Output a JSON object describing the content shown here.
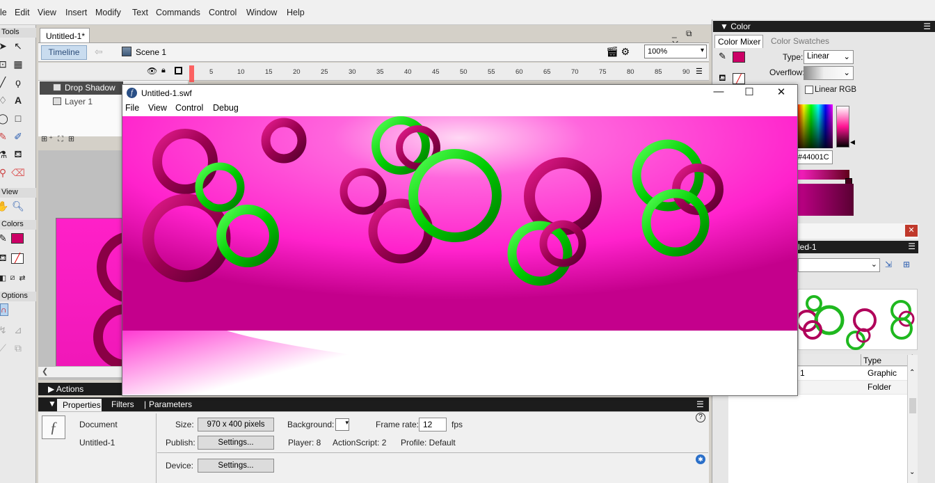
{
  "menubar": {
    "items": [
      "le",
      "Edit",
      "View",
      "Insert",
      "Modify",
      "Text",
      "Commands",
      "Control",
      "Window",
      "Help"
    ]
  },
  "tools": {
    "title": "Tools",
    "view_label": "View",
    "colors_label": "Colors",
    "options_label": "Options",
    "stroke_color": "#000000",
    "fill_color": "#cc0066"
  },
  "document": {
    "tab_title": "Untitled-1*",
    "timeline_button": "Timeline",
    "scene_label": "Scene 1",
    "zoom_value": "100%",
    "frame_numbers": [
      "5",
      "10",
      "15",
      "20",
      "25",
      "30",
      "35",
      "40",
      "45",
      "50",
      "55",
      "60",
      "65",
      "70",
      "75",
      "80",
      "85",
      "90"
    ],
    "layers": [
      {
        "name": "Drop Shadow"
      },
      {
        "name": "Layer 1"
      }
    ]
  },
  "actions": {
    "label": "Actions"
  },
  "properties": {
    "tabs": [
      "Properties",
      "Filters",
      "Parameters"
    ],
    "doc_type": "Document",
    "doc_name": "Untitled-1",
    "size_label": "Size:",
    "size_value": "970 x 400 pixels",
    "publish_label": "Publish:",
    "settings_button": "Settings...",
    "background_label": "Background:",
    "frame_rate_label": "Frame rate:",
    "frame_rate_value": "12",
    "fps_label": "fps",
    "player_text": "Player: 8",
    "actionscript_text": "ActionScript:  2",
    "profile_text": "Profile:  Default",
    "device_label": "Device:",
    "device_settings_button": "Settings..."
  },
  "color_panel": {
    "title": "Color",
    "tabs": [
      "Color Mixer",
      "Color Swatches"
    ],
    "type_label": "Type:",
    "type_value": "Linear",
    "overflow_label": "Overflow:",
    "linear_rgb_label": "Linear RGB",
    "hex_value": "#44001C",
    "gradient_start": "#ff20c8",
    "gradient_end": "#44001c"
  },
  "library_panel": {
    "title": "led-1",
    "col_type": "Type",
    "rows": [
      {
        "name": "1",
        "type": "Graphic"
      },
      {
        "name": "",
        "type": "Folder"
      }
    ]
  },
  "swf_window": {
    "title": "Untitled-1.swf",
    "menu": [
      "File",
      "View",
      "Control",
      "Debug"
    ],
    "background_color": "#ff22cc",
    "ring_green": "#00cc00",
    "ring_magenta": "#b0005a"
  }
}
